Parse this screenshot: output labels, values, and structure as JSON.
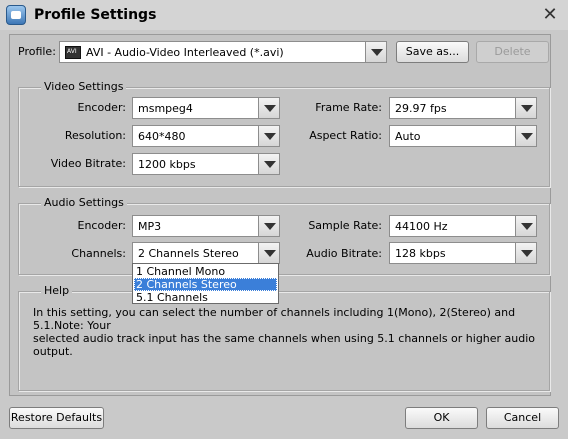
{
  "window": {
    "title": "Profile Settings"
  },
  "profile": {
    "label": "Profile:",
    "value": "AVI - Audio-Video Interleaved (*.avi)",
    "save_as": "Save as...",
    "delete": "Delete"
  },
  "video": {
    "title": "Video Settings",
    "encoder_label": "Encoder:",
    "encoder": "msmpeg4",
    "resolution_label": "Resolution:",
    "resolution": "640*480",
    "bitrate_label": "Video Bitrate:",
    "bitrate": "1200 kbps",
    "framerate_label": "Frame Rate:",
    "framerate": "29.97 fps",
    "aspect_label": "Aspect Ratio:",
    "aspect": "Auto"
  },
  "audio": {
    "title": "Audio Settings",
    "encoder_label": "Encoder:",
    "encoder": "MP3",
    "channels_label": "Channels:",
    "channels": "2 Channels Stereo",
    "samplerate_label": "Sample Rate:",
    "samplerate": "44100 Hz",
    "bitrate_label": "Audio Bitrate:",
    "bitrate": "128 kbps",
    "channel_options": [
      "1 Channel Mono",
      "2 Channels Stereo",
      "5.1 Channels"
    ],
    "selected_option_index": 1
  },
  "help": {
    "title": "Help",
    "line1": "In this setting, you can select the number of channels including 1(Mono), 2(Stereo) and 5.1.Note: Your",
    "line2": "selected audio track input has the same channels when using 5.1 channels or higher audio output."
  },
  "footer": {
    "restore": "Restore Defaults",
    "ok": "OK",
    "cancel": "Cancel"
  },
  "icons": {
    "app": "app-settings-icon",
    "close": "close-icon",
    "dropdown": "chevron-down-icon",
    "format": "avi-format-icon"
  },
  "colors": {
    "selection": "#3b7fd9",
    "background": "#c4c4c4"
  }
}
